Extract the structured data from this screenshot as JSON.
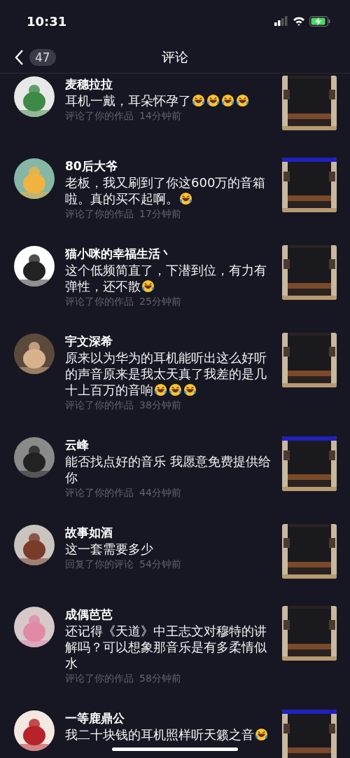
{
  "status_bar": {
    "time": "10:31"
  },
  "header": {
    "count": "47",
    "title": "评论"
  },
  "comments": [
    {
      "name": "麦穗拉拉",
      "body": [
        {
          "kind": "text",
          "text": "耳机一戴，耳朵怀孕了"
        },
        {
          "kind": "emoji"
        },
        {
          "kind": "emoji"
        },
        {
          "kind": "emoji"
        },
        {
          "kind": "emoji"
        }
      ],
      "action": "评论了你的作品",
      "time": "14分钟前"
    },
    {
      "name": "80后大爷",
      "body": [
        {
          "kind": "text",
          "text": "老板，我又刷到了你这600万的音箱啦。真的买不起啊。"
        },
        {
          "kind": "emoji"
        }
      ],
      "action": "评论了你的作品",
      "time": "17分钟前"
    },
    {
      "name": "猫小咪的幸福生活丶",
      "body": [
        {
          "kind": "text",
          "text": "这个低频简直了，下潜到位，有力有弹性，还不散"
        },
        {
          "kind": "emoji"
        }
      ],
      "action": "评论了你的作品",
      "time": "25分钟前"
    },
    {
      "name": "宇文深希",
      "body": [
        {
          "kind": "text",
          "text": "原来以为华为的耳机能听出这么好听的声音原来是我太天真了我差的是几十上百万的音响"
        },
        {
          "kind": "emoji"
        },
        {
          "kind": "emoji"
        },
        {
          "kind": "emoji"
        }
      ],
      "action": "评论了你的作品",
      "time": "38分钟前"
    },
    {
      "name": "云峰",
      "body": [
        {
          "kind": "text",
          "text": "能否找点好的音乐 我愿意免费提供给你"
        }
      ],
      "action": "评论了你的作品",
      "time": "44分钟前"
    },
    {
      "name": "故事如酒",
      "body": [
        {
          "kind": "text",
          "text": "这一套需要多少"
        }
      ],
      "action": "回复了你的评论",
      "time": "54分钟前"
    },
    {
      "name": "成偶芭芭",
      "body": [
        {
          "kind": "text",
          "text": "还记得《天道》中王志文对穆特的讲解吗？可以想象那音乐是有多柔情似水"
        }
      ],
      "action": "评论了你的作品",
      "time": "58分钟前"
    },
    {
      "name": "一等鹿鼎公",
      "body": [
        {
          "kind": "text",
          "text": "我二十块钱的耳机照样听天籁之音"
        },
        {
          "kind": "emoji"
        }
      ]
    }
  ]
}
